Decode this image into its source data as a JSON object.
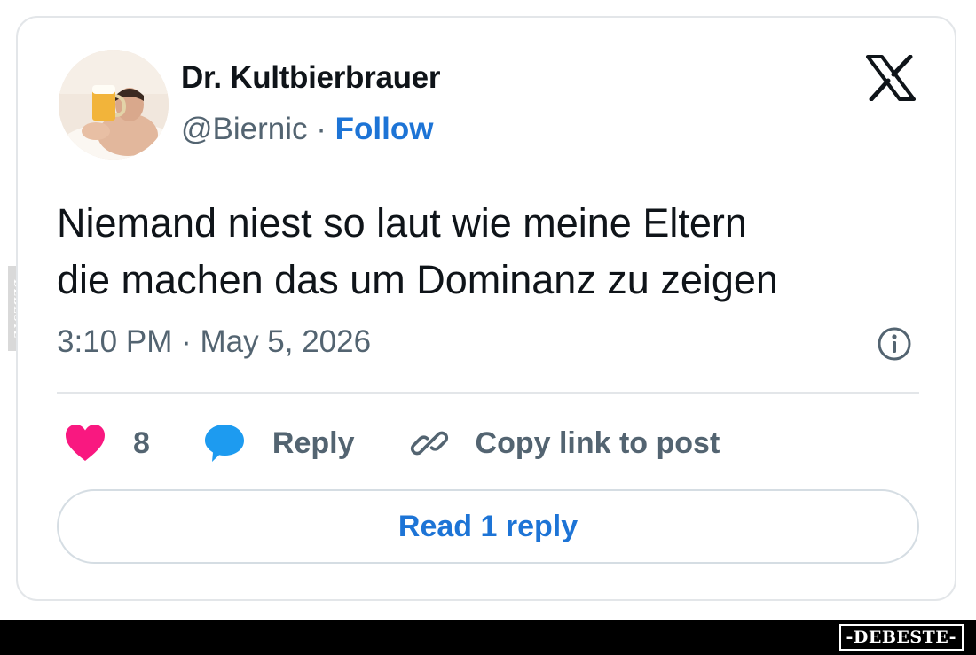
{
  "watermark": {
    "side_text": "DEBESTE",
    "bottom_text": "-DEBESTE-"
  },
  "tweet": {
    "author": {
      "display_name": "Dr. Kultbierbrauer",
      "handle": "@Biernic",
      "separator": " · ",
      "follow_label": "Follow",
      "avatar_icon": "avatar-photo-beer"
    },
    "platform_icon": "x-logo-icon",
    "text_lines": [
      "Niemand niest so laut wie meine Eltern",
      "die machen das um Dominanz zu zeigen"
    ],
    "timestamp": "3:10 PM · May 5, 2026",
    "info_icon": "info-icon",
    "actions": {
      "like_count": "8",
      "reply_label": "Reply",
      "copy_label": "Copy link to post"
    },
    "read_reply_label": "Read 1 reply"
  },
  "colors": {
    "link_blue": "#1d74d6",
    "heart_pink": "#f91880",
    "reply_bubble_blue": "#1d9bf0",
    "muted_text": "#536471",
    "border": "#e3e6e9"
  }
}
